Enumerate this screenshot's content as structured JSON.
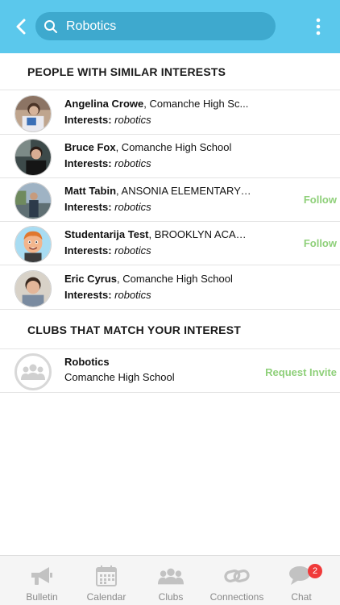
{
  "header": {
    "search_value": "Robotics",
    "accent_color": "#5bc8ec"
  },
  "sections": {
    "people_title": "PEOPLE WITH SIMILAR INTERESTS",
    "clubs_title": "CLUBS THAT MATCH YOUR INTEREST"
  },
  "people": [
    {
      "name": "Angelina Crowe",
      "school": ", Comanche High Sc...",
      "interests_label": "Interests:",
      "interests": "robotics",
      "action": ""
    },
    {
      "name": "Bruce Fox",
      "school": ", Comanche High School",
      "interests_label": "Interests:",
      "interests": "robotics",
      "action": ""
    },
    {
      "name": "Matt Tabin",
      "school": ", ANSONIA ELEMENTARY ...",
      "interests_label": "Interests:",
      "interests": "robotics",
      "action": "Follow"
    },
    {
      "name": "Studentarija Test",
      "school": ", BROOKLYN ACAD...",
      "interests_label": "Interests:",
      "interests": "robotics",
      "action": "Follow"
    },
    {
      "name": "Eric Cyrus",
      "school": ", Comanche High School",
      "interests_label": "Interests:",
      "interests": "robotics",
      "action": ""
    }
  ],
  "clubs": [
    {
      "name": "Robotics",
      "school": "Comanche High School",
      "action": "Request Invite"
    }
  ],
  "tabs": [
    {
      "label": "Bulletin",
      "icon": "megaphone-icon"
    },
    {
      "label": "Calendar",
      "icon": "calendar-icon"
    },
    {
      "label": "Clubs",
      "icon": "group-icon"
    },
    {
      "label": "Connections",
      "icon": "link-icon"
    },
    {
      "label": "Chat",
      "icon": "chat-icon",
      "badge": "2"
    }
  ],
  "colors": {
    "action_green": "#8fd07a",
    "badge_red": "#f03a3a"
  }
}
